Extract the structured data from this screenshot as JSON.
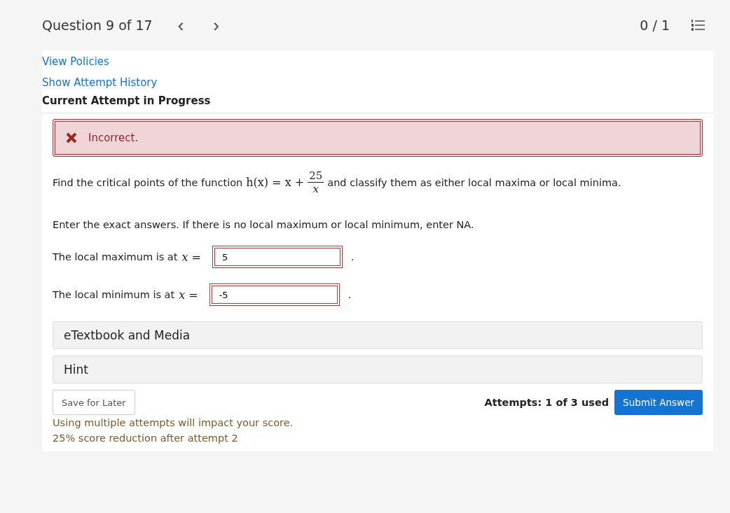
{
  "header": {
    "title": "Question 9 of 17",
    "prev": "‹",
    "next": "›",
    "score": "0 / 1"
  },
  "links": [
    "View Policies",
    "Show Attempt History"
  ],
  "attempt_heading": "Current Attempt in Progress",
  "feedback": {
    "kind": "incorrect",
    "text": "Incorrect."
  },
  "question": {
    "before": "Find the critical points of the function",
    "lhs": "h(x) = x +",
    "numerator": "25",
    "denominator": "x",
    "after": "and classify them as either local maxima or local minima."
  },
  "instructions": "Enter the exact answers. If there is no local maximum or local minimum, enter NA.",
  "answers": [
    {
      "label": "The local maximum is at",
      "variable": "x =",
      "value": "5",
      "incorrect": true,
      "end": "."
    },
    {
      "label": "The local minimum is at",
      "variable": "x =",
      "value": "-5",
      "incorrect": true,
      "end": "."
    }
  ],
  "panels": [
    "eTextbook and Media",
    "Hint"
  ],
  "save_button": "Save for Later",
  "attempts": "Attempts: 1 of 3 used",
  "submit_button": "Submit Answer",
  "notes": [
    "Using multiple attempts will impact your score.",
    "25% score reduction after attempt 2"
  ]
}
